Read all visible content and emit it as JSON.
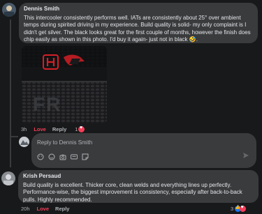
{
  "comments": [
    {
      "author": "Dennis Smith",
      "text": "This intercooler consistently performs well. IATs are consistently about 25° over ambient temps during spirited driving in my experience. Build quality is solid- my only complaint is I didn't get silver. The black looks great for the first couple of months, however the finish does chip easily as shown in this photo. I'd buy it again- just not in black 🤣.",
      "time": "3h",
      "love": "Love",
      "reply": "Reply",
      "reactions_count": "1",
      "photo_badge_text": "FR",
      "accent": "#3a3b3c"
    },
    {
      "author": "Krish Persaud",
      "text": "Build quality is excellent. Thicker core, clean welds and everything lines up perfectly. Performance-wise, the biggest improvement is consistency, especially after back-to-back pulls. Highly recommended.",
      "time": "20h",
      "love": "Love",
      "reply": "Reply",
      "reactions_count": "3"
    }
  ],
  "reply_box": {
    "placeholder": "Reply to Dennis Smith",
    "icons": [
      "sticker-icon",
      "emoji-icon",
      "camera-icon",
      "gif-icon",
      "sticker-icon"
    ],
    "send_icon": "send-icon"
  },
  "colors": {
    "background": "#18191a",
    "bubble": "#3a3b3c",
    "love": "#f33e58",
    "like": "#1877f2",
    "muted": "#b0b3b8"
  }
}
